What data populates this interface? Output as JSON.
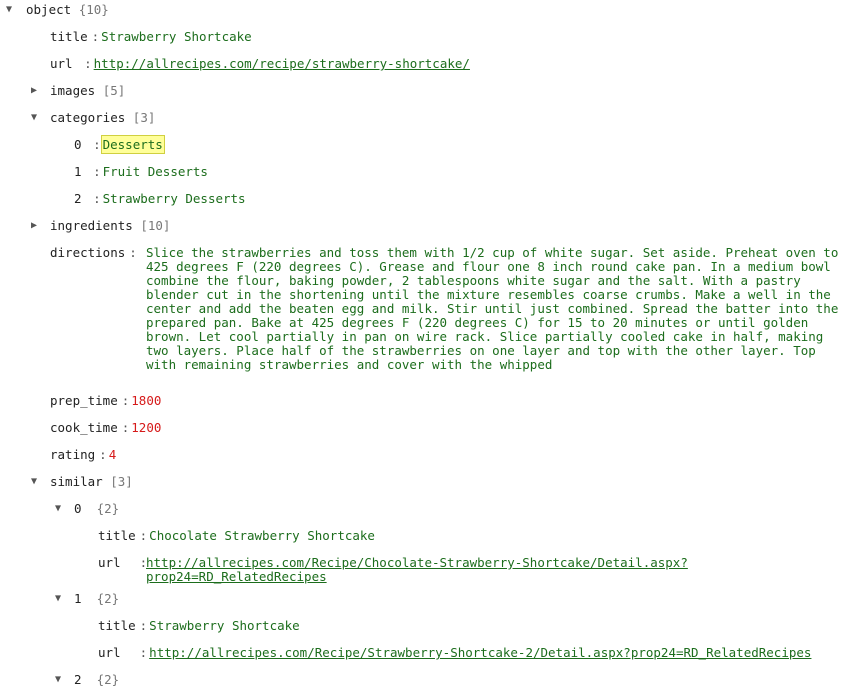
{
  "root": {
    "label": "object",
    "count": "{10}"
  },
  "title": {
    "key": "title",
    "value": "Strawberry Shortcake"
  },
  "url": {
    "key": "url",
    "value": "http://allrecipes.com/recipe/strawberry-shortcake/"
  },
  "images": {
    "key": "images",
    "count": "[5]"
  },
  "categories": {
    "key": "categories",
    "count": "[3]",
    "items": [
      {
        "index": "0",
        "value": "Desserts"
      },
      {
        "index": "1",
        "value": "Fruit Desserts"
      },
      {
        "index": "2",
        "value": "Strawberry Desserts"
      }
    ]
  },
  "ingredients": {
    "key": "ingredients",
    "count": "[10]"
  },
  "directions": {
    "key": "directions",
    "value": "Slice the strawberries and toss them with 1/2 cup of white sugar. Set aside. Preheat oven to 425 degrees F (220 degrees C). Grease and flour one 8 inch round cake pan. In a medium bowl combine the flour, baking powder, 2 tablespoons white sugar and the salt. With a pastry blender cut in the shortening until the mixture resembles coarse crumbs. Make a well in the center and add the beaten egg and milk. Stir until just combined. Spread the batter into the prepared pan. Bake at 425 degrees F (220 degrees C) for 15 to 20 minutes or until golden brown. Let cool partially in pan on wire rack. Slice partially cooled cake in half, making two layers. Place half of the strawberries on one layer and top with the other layer. Top with remaining strawberries and cover with the whipped"
  },
  "prep_time": {
    "key": "prep_time",
    "value": "1800"
  },
  "cook_time": {
    "key": "cook_time",
    "value": "1200"
  },
  "rating": {
    "key": "rating",
    "value": "4"
  },
  "similar": {
    "key": "similar",
    "count": "[3]",
    "items": [
      {
        "index": "0",
        "count": "{2}",
        "title_key": "title",
        "title": "Chocolate Strawberry Shortcake",
        "url_key": "url",
        "url_line1": "http://allrecipes.com/Recipe/Chocolate-Strawberry-Shortcake/Detail.aspx?",
        "url_line2": "prop24=RD_RelatedRecipes"
      },
      {
        "index": "1",
        "count": "{2}",
        "title_key": "title",
        "title": "Strawberry Shortcake",
        "url_key": "url",
        "url": "http://allrecipes.com/Recipe/Strawberry-Shortcake-2/Detail.aspx?prop24=RD_RelatedRecipes"
      },
      {
        "index": "2",
        "count": "{2}"
      }
    ]
  }
}
